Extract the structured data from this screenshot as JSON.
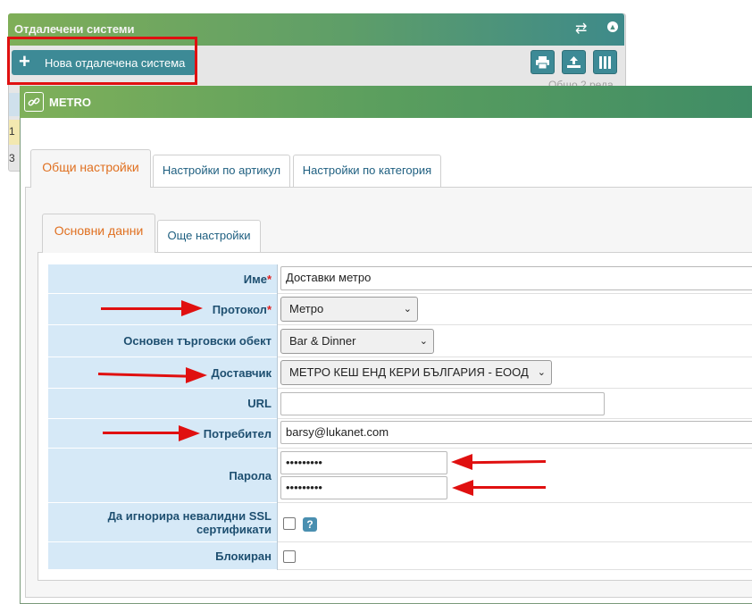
{
  "background_panel": {
    "title": "Отдалечени системи",
    "new_button_label": "Нова отдалечена система",
    "new_button_icon": "plus-icon",
    "toolbar_icons": [
      "print-icon",
      "export-icon",
      "columns-icon"
    ],
    "total_text": "Общо 2 реда",
    "row_numbers": [
      "1",
      "3"
    ]
  },
  "modal": {
    "title": "METRO",
    "tabs": [
      {
        "label": "Общи настройки",
        "active": true
      },
      {
        "label": "Настройки по артикул",
        "active": false
      },
      {
        "label": "Настройки по категория",
        "active": false
      }
    ],
    "subtabs": [
      {
        "label": "Основни данни",
        "active": true
      },
      {
        "label": "Още настройки",
        "active": false
      }
    ],
    "form": {
      "name_label": "Име",
      "name_value": "Доставки метро",
      "protocol_label": "Протокол",
      "protocol_value": "Метро",
      "store_label": "Основен търговски обект",
      "store_value": "Bar & Dinner",
      "supplier_label": "Доставчик",
      "supplier_value": "МЕТРО КЕШ ЕНД КЕРИ БЪЛГАРИЯ - ЕООД",
      "url_label": "URL",
      "url_value": "",
      "user_label": "Потребител",
      "user_value": "barsy@lukanet.com",
      "password_label": "Парола",
      "password_value": "•••••••••",
      "password_confirm_value": "•••••••••",
      "ssl_label": "Да игнорира невалидни SSL сертификати",
      "ssl_checked": false,
      "blocked_label": "Блокиран",
      "blocked_checked": false,
      "required_mark": "*",
      "help_mark": "?"
    }
  },
  "colors": {
    "header_green": "#6aa85e",
    "teal_button": "#3d8a96",
    "label_bg": "#d6e9f7",
    "label_text": "#1e4f70",
    "active_tab": "#e07020",
    "annotation_red": "#e01010"
  }
}
